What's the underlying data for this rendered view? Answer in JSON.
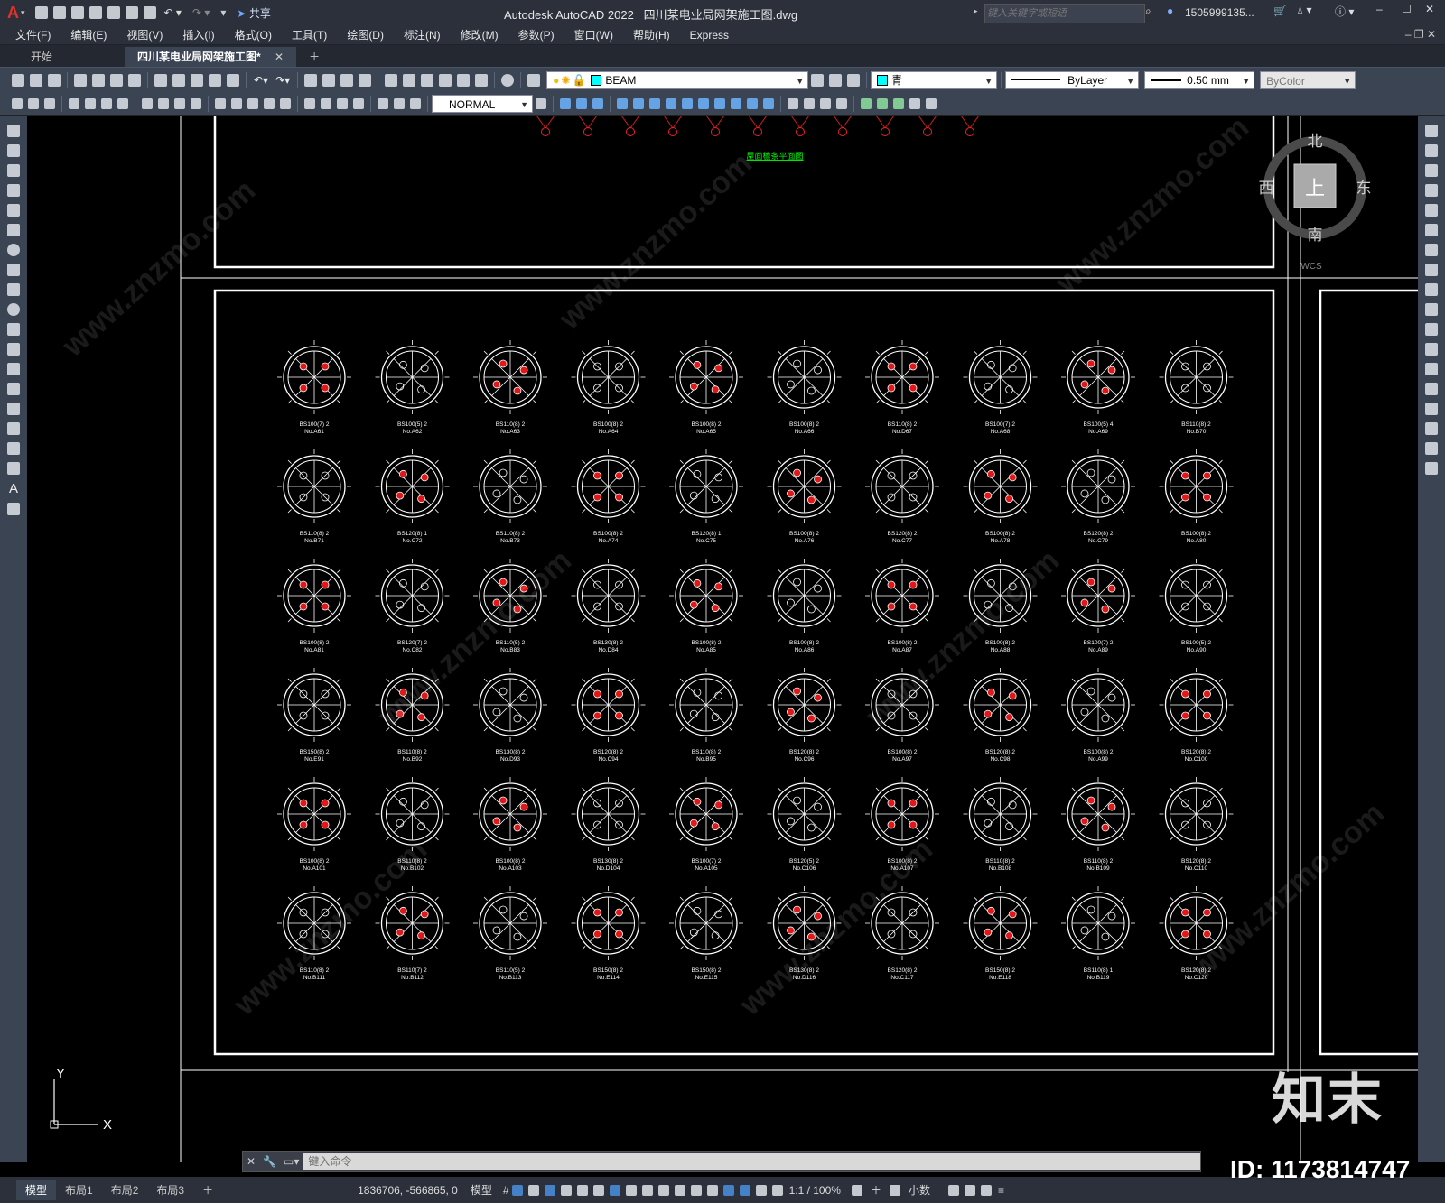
{
  "titlebar": {
    "app_title": "Autodesk AutoCAD 2022",
    "file_name": "四川某电业局网架施工图.dwg",
    "share_label": "共享",
    "search_placeholder": "键入关键字或短语",
    "user": "1505999135..."
  },
  "menu": [
    "文件(F)",
    "编辑(E)",
    "视图(V)",
    "插入(I)",
    "格式(O)",
    "工具(T)",
    "绘图(D)",
    "标注(N)",
    "修改(M)",
    "参数(P)",
    "窗口(W)",
    "帮助(H)",
    "Express"
  ],
  "tabs": {
    "start": "开始",
    "doc": "四川某电业局网架施工图*"
  },
  "toolbar": {
    "layer": "BEAM",
    "color": "青",
    "linetype": "ByLayer",
    "lineweight": "0.50 mm",
    "plotstyle": "ByColor",
    "textstyle": "NORMAL"
  },
  "viewcube": {
    "north": "北",
    "south": "南",
    "east": "东",
    "west": "西",
    "top": "上",
    "wcs": "WCS"
  },
  "drawing": {
    "caption": "屋面檩条平面图",
    "rows": [
      [
        [
          "BS100(7) 2",
          "No.A61"
        ],
        [
          "BS100(5) 2",
          "No.A62"
        ],
        [
          "BS110(8) 2",
          "No.A63"
        ],
        [
          "BS100(8) 2",
          "No.A64"
        ],
        [
          "BS100(8) 2",
          "No.A65"
        ],
        [
          "BS100(8) 2",
          "No.A66"
        ],
        [
          "BS110(8) 2",
          "No.D67"
        ],
        [
          "BS100(7) 2",
          "No.A68"
        ],
        [
          "BS100(5) 4",
          "No.A69"
        ],
        [
          "BS110(8) 2",
          "No.B70"
        ]
      ],
      [
        [
          "BS110(8) 2",
          "No.B71"
        ],
        [
          "BS120(8) 1",
          "No.C72"
        ],
        [
          "BS110(8) 2",
          "No.B73"
        ],
        [
          "BS100(8) 2",
          "No.A74"
        ],
        [
          "BS120(8) 1",
          "No.C75"
        ],
        [
          "BS100(8) 2",
          "No.A76"
        ],
        [
          "BS120(8) 2",
          "No.C77"
        ],
        [
          "BS100(8) 2",
          "No.A78"
        ],
        [
          "BS120(8) 2",
          "No.C79"
        ],
        [
          "BS100(8) 2",
          "No.A80"
        ]
      ],
      [
        [
          "BS100(8) 2",
          "No.A81"
        ],
        [
          "BS120(7) 2",
          "No.C82"
        ],
        [
          "BS110(5) 2",
          "No.B83"
        ],
        [
          "BS130(8) 2",
          "No.D84"
        ],
        [
          "BS100(8) 2",
          "No.A85"
        ],
        [
          "BS100(8) 2",
          "No.A86"
        ],
        [
          "BS100(8) 2",
          "No.A87"
        ],
        [
          "BS100(8) 2",
          "No.A88"
        ],
        [
          "BS100(7) 2",
          "No.A89"
        ],
        [
          "BS100(5) 2",
          "No.A90"
        ]
      ],
      [
        [
          "BS150(8) 2",
          "No.E91"
        ],
        [
          "BS110(8) 2",
          "No.B92"
        ],
        [
          "BS130(8) 2",
          "No.D93"
        ],
        [
          "BS120(8) 2",
          "No.C94"
        ],
        [
          "BS110(8) 2",
          "No.B95"
        ],
        [
          "BS120(8) 2",
          "No.C96"
        ],
        [
          "BS100(8) 2",
          "No.A97"
        ],
        [
          "BS120(8) 2",
          "No.C98"
        ],
        [
          "BS100(8) 2",
          "No.A99"
        ],
        [
          "BS120(8) 2",
          "No.C100"
        ]
      ],
      [
        [
          "BS100(8) 2",
          "No.A101"
        ],
        [
          "BS110(8) 2",
          "No.B102"
        ],
        [
          "BS100(8) 2",
          "No.A103"
        ],
        [
          "BS130(8) 2",
          "No.D104"
        ],
        [
          "BS100(7) 2",
          "No.A105"
        ],
        [
          "BS120(5) 2",
          "No.C106"
        ],
        [
          "BS100(8) 2",
          "No.A107"
        ],
        [
          "BS110(8) 2",
          "No.B108"
        ],
        [
          "BS110(8) 2",
          "No.B109"
        ],
        [
          "BS120(8) 2",
          "No.C110"
        ]
      ],
      [
        [
          "BS110(8) 2",
          "No.B111"
        ],
        [
          "BS110(7) 2",
          "No.B112"
        ],
        [
          "BS110(5) 2",
          "No.B113"
        ],
        [
          "BS150(8) 2",
          "No.E114"
        ],
        [
          "BS150(8) 2",
          "No.E115"
        ],
        [
          "BS130(8) 2",
          "No.D116"
        ],
        [
          "BS120(8) 2",
          "No.C117"
        ],
        [
          "BS150(8) 2",
          "No.E118"
        ],
        [
          "BS110(8) 1",
          "No.B119"
        ],
        [
          "BS120(8) 2",
          "No.C120"
        ]
      ]
    ]
  },
  "ucs": {
    "x": "X",
    "y": "Y"
  },
  "command": {
    "placeholder": "键入命令"
  },
  "status": {
    "coords": "1836706, -566865, 0",
    "model_label": "模型",
    "scale": "1:1 / 100%",
    "units": "小数",
    "layout_tabs": [
      "模型",
      "布局1",
      "布局2",
      "布局3"
    ]
  },
  "watermark": {
    "brand": "知末",
    "id": "ID: 1173814747",
    "url": "www.znzmo.com"
  }
}
